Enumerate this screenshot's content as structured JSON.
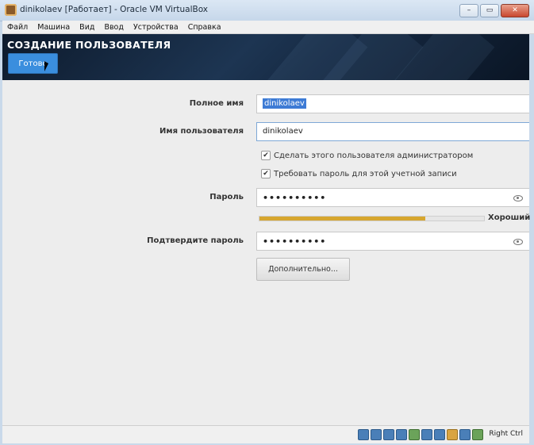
{
  "window": {
    "title": "dinikolaev [Работает] - Oracle VM VirtualBox",
    "minimize_glyph": "–",
    "restore_glyph": "▭",
    "close_glyph": "✕"
  },
  "menubar": {
    "items": [
      "Файл",
      "Машина",
      "Вид",
      "Ввод",
      "Устройства",
      "Справка"
    ]
  },
  "header": {
    "title": "СОЗДАНИЕ ПОЛЬЗОВАТЕЛЯ",
    "done_label": "Готово"
  },
  "form": {
    "full_name_label": "Полное имя",
    "full_name_value": "dinikolaev",
    "username_label": "Имя пользователя",
    "username_value": "dinikolaev",
    "admin_checkbox_label": "Сделать этого пользователя администратором",
    "admin_checked": true,
    "require_password_label": "Требовать пароль для этой учетной записи",
    "require_password_checked": true,
    "password_label": "Пароль",
    "password_value": "••••••••••",
    "password_strength": 0.74,
    "strength_label": "Хороший",
    "confirm_label": "Подтвердите пароль",
    "confirm_value": "••••••••••",
    "advanced_button": "Дополнительно..."
  },
  "statusbar": {
    "host_key": "Right Ctrl"
  },
  "colors": {
    "accent": "#3a8ede",
    "strength": "#d7a62f",
    "header_bg": "#16263b"
  }
}
